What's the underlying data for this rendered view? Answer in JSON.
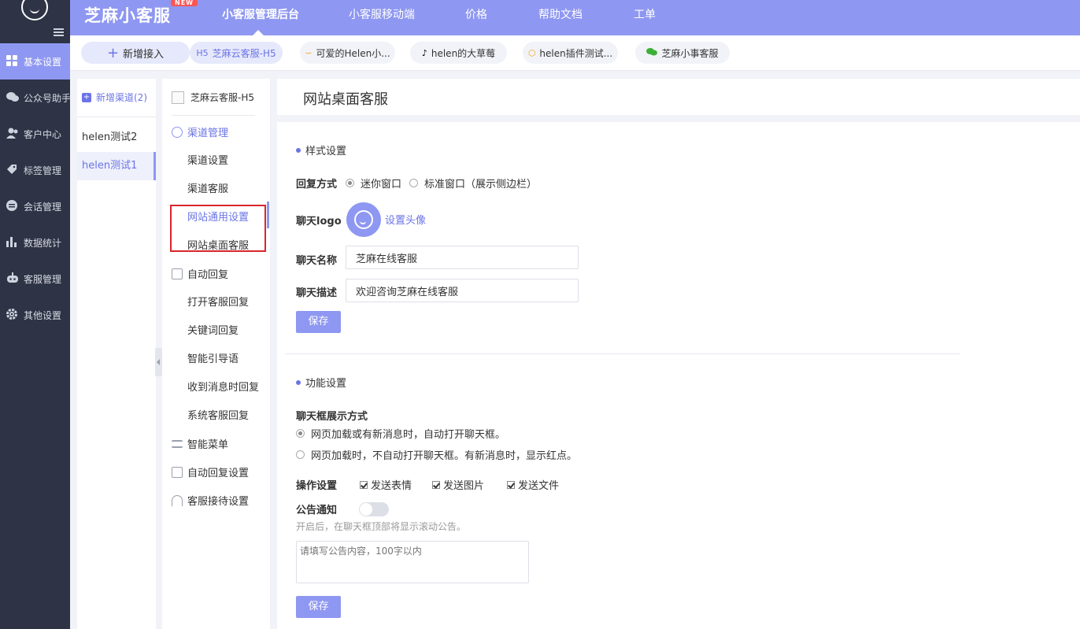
{
  "app": {
    "brand": "芝麻小客服",
    "badge": "NEW"
  },
  "top_nav": {
    "tabs": [
      "小客服管理后台",
      "小客服移动端",
      "价格",
      "帮助文档",
      "工单"
    ]
  },
  "left_nav": {
    "items": [
      "基本设置",
      "公众号助手",
      "客户中心",
      "标签管理",
      "会话管理",
      "数据统计",
      "客服管理",
      "其他设置"
    ]
  },
  "channels_bar": {
    "add_label": "新增接入",
    "chips": [
      {
        "icon": "H5",
        "label": "芝麻云客服-H5"
      },
      {
        "icon": "mini-program-icon",
        "label": "可爱的Helen小..."
      },
      {
        "icon": "tiktok-icon",
        "label": "helen的大草莓"
      },
      {
        "icon": "plugin-icon",
        "label": "helen插件测试..."
      },
      {
        "icon": "wechat-icon",
        "label": "芝麻小事客服"
      }
    ]
  },
  "channel_list": {
    "new_label": "新增渠道(2)",
    "items": [
      "helen测试2",
      "helen测试1"
    ]
  },
  "settings_menu": {
    "header": "芝麻云客服-H5",
    "group1": "渠道管理",
    "group1_items": [
      "渠道设置",
      "渠道客服",
      "网站通用设置",
      "网站桌面客服"
    ],
    "group2": "自动回复",
    "group2_items": [
      "打开客服回复",
      "关键词回复",
      "智能引导语",
      "收到消息时回复",
      "系统客服回复"
    ],
    "others": [
      "智能菜单",
      "自动回复设置",
      "客服接待设置"
    ]
  },
  "page": {
    "title": "网站桌面客服"
  },
  "style_section": {
    "title": "样式设置",
    "reply_mode_label": "回复方式",
    "reply_options": [
      "迷你窗口",
      "标准窗口（展示侧边栏）"
    ],
    "selected_reply_mode": "迷你窗口",
    "logo_label": "聊天logo",
    "set_avatar": "设置头像",
    "name_label": "聊天名称",
    "name_value": "芝麻在线客服",
    "desc_label": "聊天描述",
    "desc_value": "欢迎咨询芝麻在线客服",
    "save": "保存"
  },
  "func_section": {
    "title": "功能设置",
    "display_label": "聊天框展示方式",
    "display_options": [
      "网页加载或有新消息时，自动打开聊天框。",
      "网页加载时，不自动打开聊天框。有新消息时，显示红点。"
    ],
    "selected_display": "网页加载或有新消息时，自动打开聊天框。",
    "ops_label": "操作设置",
    "ops": [
      {
        "label": "发送表情",
        "checked": true
      },
      {
        "label": "发送图片",
        "checked": true
      },
      {
        "label": "发送文件",
        "checked": true
      }
    ],
    "notice_label": "公告通知",
    "notice_enabled": false,
    "notice_hint": "开启后，在聊天框顶部将显示滚动公告。",
    "notice_placeholder": "请填写公告内容，100字以内",
    "save": "保存"
  },
  "colors": {
    "accent": "#8e97f1",
    "sidebar": "#2e3345",
    "highlight_box": "#d9262c"
  }
}
